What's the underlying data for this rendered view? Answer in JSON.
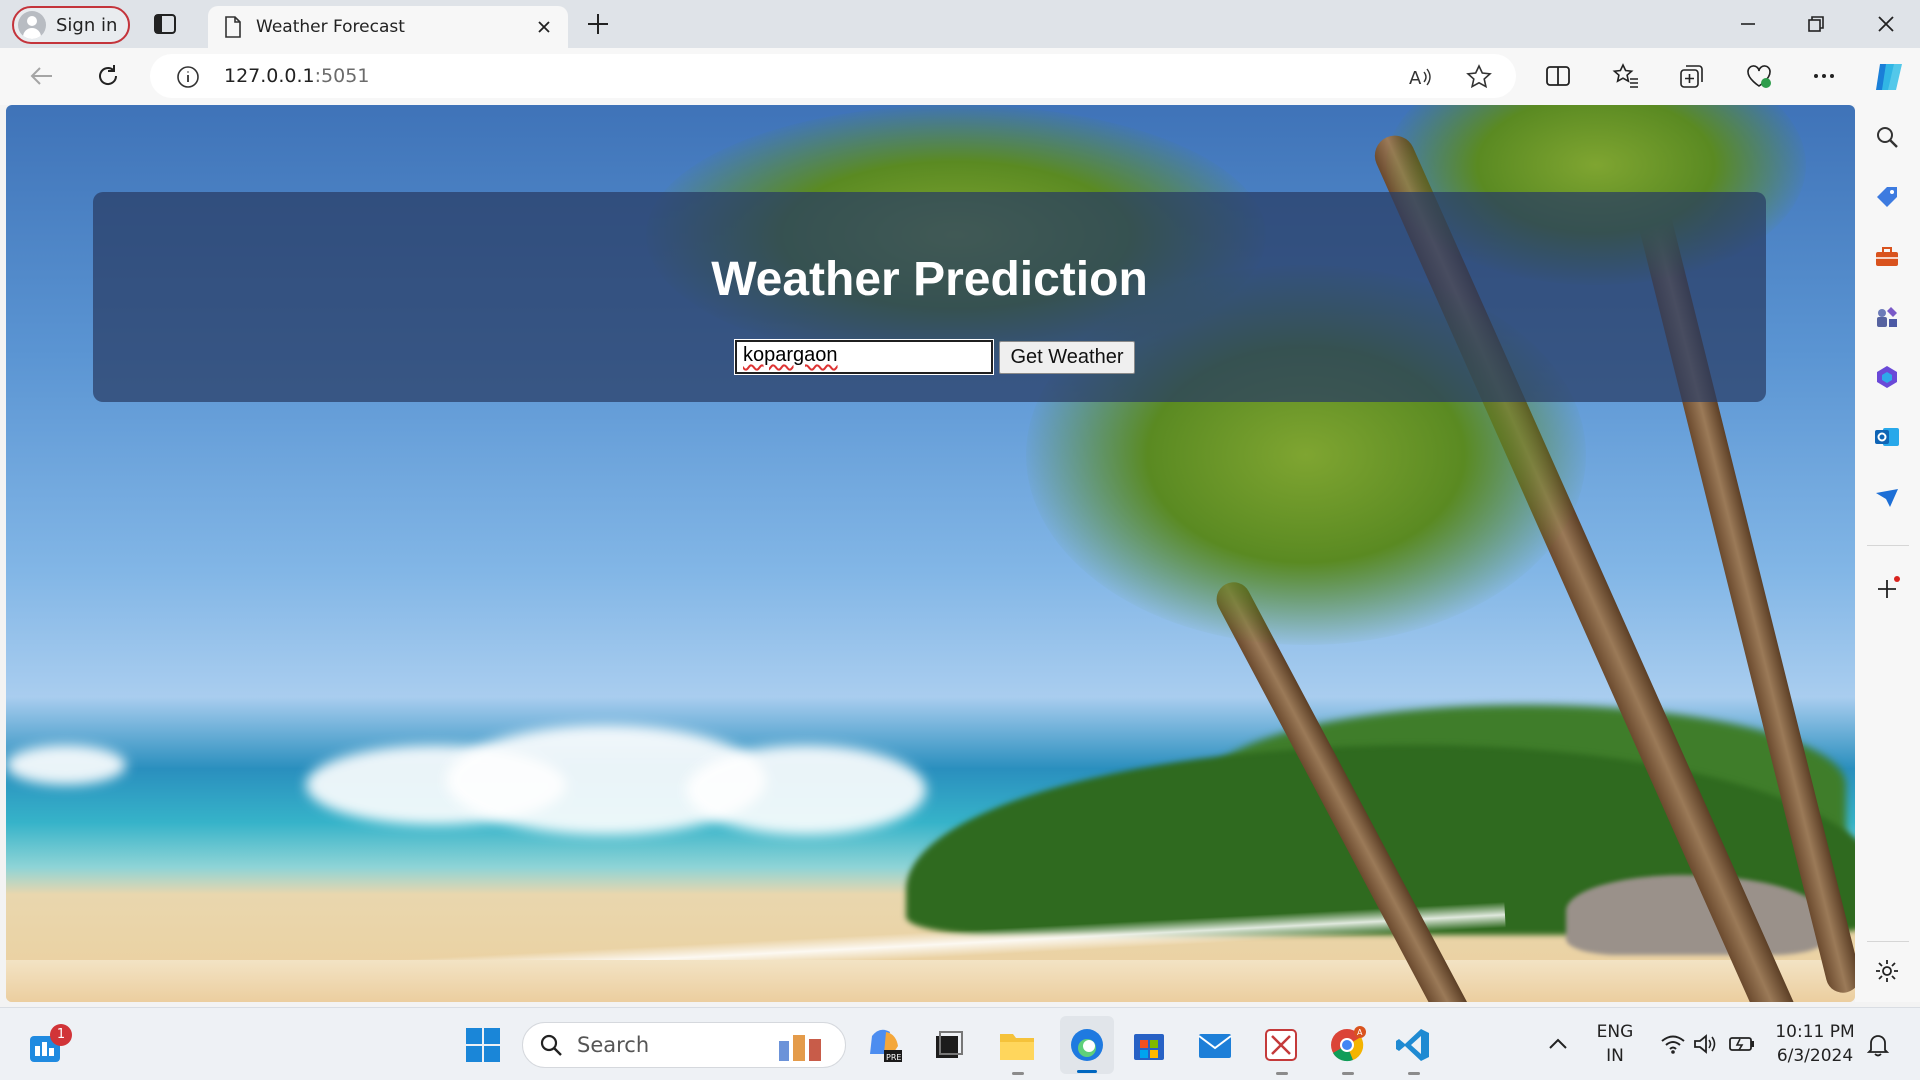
{
  "browser": {
    "signin_label": "Sign in",
    "tab_title": "Weather Forecast",
    "url_host": "127.0.0.1",
    "url_port": ":5051"
  },
  "page": {
    "heading": "Weather Prediction",
    "city_input_value": "kopargaon",
    "get_weather_label": "Get Weather"
  },
  "taskbar": {
    "search_label": "Search",
    "widgets_badge": "1",
    "language_line1": "ENG",
    "language_line2": "IN",
    "time": "10:11 PM",
    "date": "6/3/2024"
  },
  "colors": {
    "accent_blue": "#0067c0",
    "card_bg": "rgba(40,60,100,0.72)",
    "signin_border": "#c4343b"
  }
}
